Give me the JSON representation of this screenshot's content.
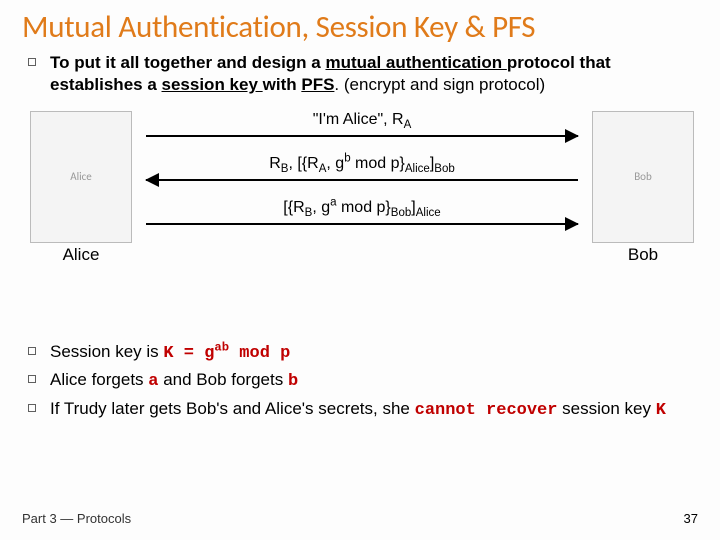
{
  "title": "Mutual Authentication, Session Key & PFS",
  "intro": {
    "pre": "To put it all together and design a ",
    "mutual": "mutual authentication ",
    "mid1": "protocol that establishes a ",
    "session": "session key ",
    "mid2": "with ",
    "pfs": "PFS",
    "tail": ". (encrypt and sign protocol)"
  },
  "parties": {
    "alice": "Alice",
    "bob": "Bob"
  },
  "messages": {
    "m1": {
      "q": "\"I'm Alice\", R",
      "ra_sub": "A"
    },
    "m2": {
      "rb": "R",
      "rb_sub": "B",
      "sep": ", [{R",
      "ra_sub": "A",
      "g": ", g",
      "exp": "b",
      "modp": " mod p}",
      "enc_sub": "Alice",
      "close": "]",
      "sig_sub": "Bob"
    },
    "m3": {
      "open": "[{R",
      "rb_sub": "B",
      "g": ", g",
      "exp": "a",
      "modp": " mod p}",
      "enc_sub": "Bob",
      "close": "]",
      "sig_sub": "Alice"
    }
  },
  "points": {
    "p1": {
      "a": "Session key is ",
      "k": "K = g",
      "exp": "ab",
      "tail": " mod p"
    },
    "p2": {
      "a": "Alice forgets ",
      "ae": "a",
      "b": " and Bob forgets ",
      "be": "b"
    },
    "p3": {
      "a": "If Trudy later gets Bob's and Alice's secrets, she ",
      "cr": "cannot recover",
      "b": " session key ",
      "k": "K"
    }
  },
  "footer": "Part 3 — Protocols",
  "page": "37",
  "placeholders": {
    "alice_img": "Alice",
    "bob_img": "Bob"
  }
}
